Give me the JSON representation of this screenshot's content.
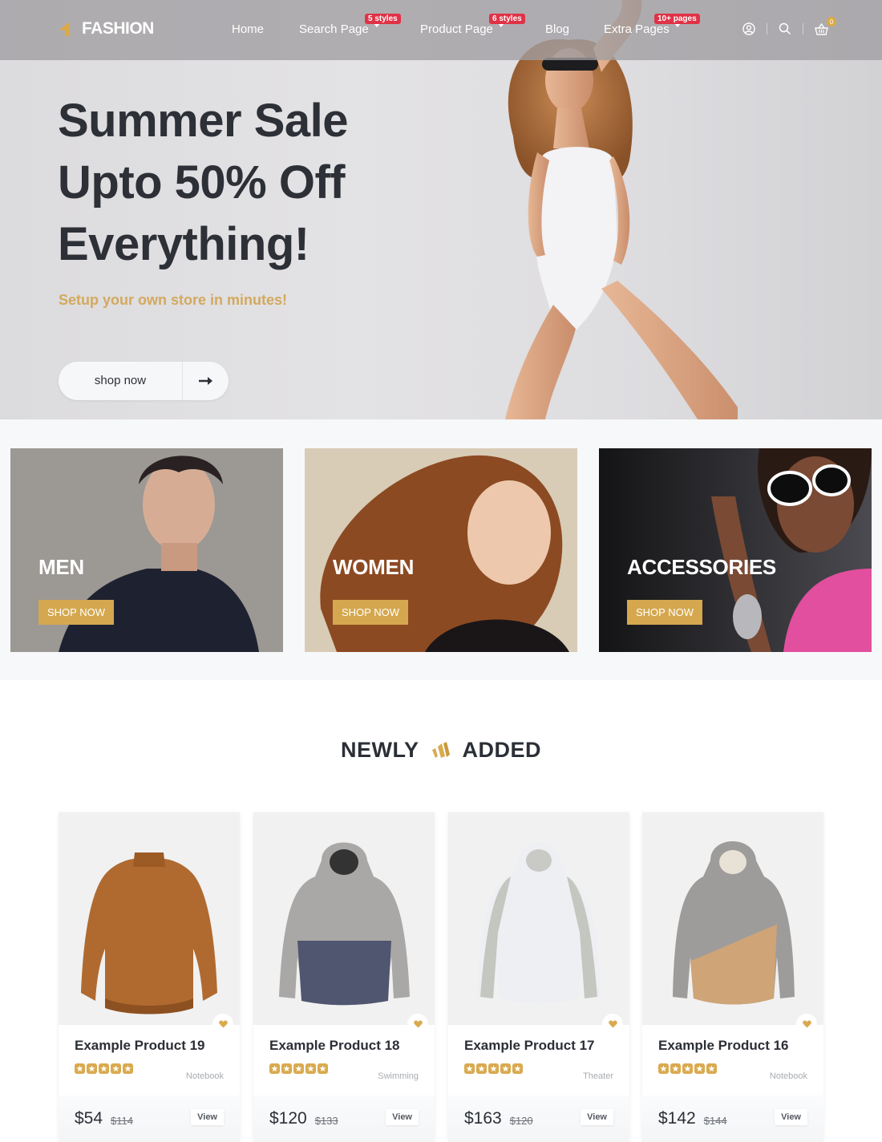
{
  "brand": {
    "name": "FASHION",
    "accent_color": "#dcaa45"
  },
  "nav": {
    "items": [
      {
        "label": "Home",
        "badge": null,
        "dropdown": false
      },
      {
        "label": "Search Page",
        "badge": "5 styles",
        "dropdown": true
      },
      {
        "label": "Product Page",
        "badge": "6 styles",
        "dropdown": true
      },
      {
        "label": "Blog",
        "badge": null,
        "dropdown": false
      },
      {
        "label": "Extra Pages",
        "badge": "10+ pages",
        "dropdown": true
      }
    ],
    "icons": [
      "user-icon",
      "search-icon",
      "cart-icon"
    ],
    "cart_count": "0"
  },
  "hero": {
    "title_lines": [
      "Summer Sale",
      "Upto 50% Off",
      "Everything!"
    ],
    "subtitle": "Setup your own store in minutes!",
    "cta_label": "shop now"
  },
  "categories": [
    {
      "name": "MEN",
      "button": "SHOP NOW"
    },
    {
      "name": "WOMEN",
      "button": "SHOP NOW"
    },
    {
      "name": "ACCESSORIES",
      "button": "SHOP NOW"
    }
  ],
  "newly_added": {
    "title_left": "NEWLY",
    "title_right": "ADDED",
    "products": [
      {
        "name": "Example Product 19",
        "category": "Notebook",
        "price": "$54",
        "old_price": "$114",
        "rating": 5,
        "view_label": "View"
      },
      {
        "name": "Example Product 18",
        "category": "Swimming",
        "price": "$120",
        "old_price": "$133",
        "rating": 5,
        "view_label": "View"
      },
      {
        "name": "Example Product 17",
        "category": "Theater",
        "price": "$163",
        "old_price": "$120",
        "rating": 5,
        "view_label": "View"
      },
      {
        "name": "Example Product 16",
        "category": "Notebook",
        "price": "$142",
        "old_price": "$144",
        "rating": 5,
        "view_label": "View"
      }
    ]
  }
}
